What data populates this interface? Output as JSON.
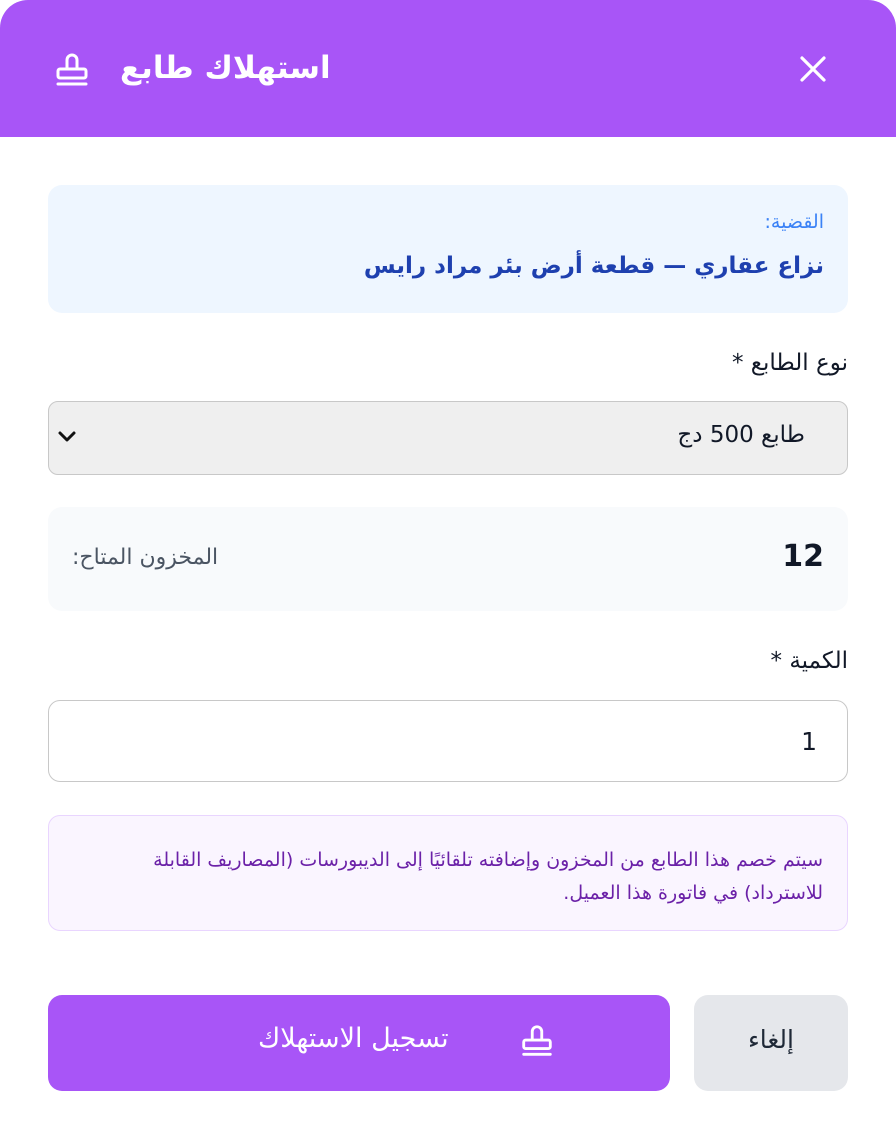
{
  "colors": {
    "accent": "#a855f7",
    "case_background": "#eef6ff",
    "notice_background": "#faf5ff",
    "notice_text": "#6b21a8"
  },
  "dialog": {
    "title": "استهلاك طابع",
    "title_icon": "stamp-icon",
    "close_icon": "close-icon"
  },
  "case": {
    "label": "القضية:",
    "value": "نزاع عقاري — قطعة أرض بئر مراد رايس"
  },
  "stamp_type": {
    "label": "نوع الطابع *",
    "selected": "طابع 500 دج",
    "dropdown_icon": "chevron-down-icon"
  },
  "stock": {
    "label": "المخزون المتاح:",
    "value": "12"
  },
  "quantity": {
    "label": "الكمية *",
    "value": "1"
  },
  "notice": {
    "text": "سيتم خصم هذا الطابع من المخزون وإضافته تلقائيًا إلى الديبورسات (المصاريف القابلة للاسترداد) في فاتورة هذا العميل."
  },
  "actions": {
    "submit_label": "تسجيل الاستهلاك",
    "submit_icon": "stamp-icon",
    "cancel_label": "إلغاء"
  }
}
